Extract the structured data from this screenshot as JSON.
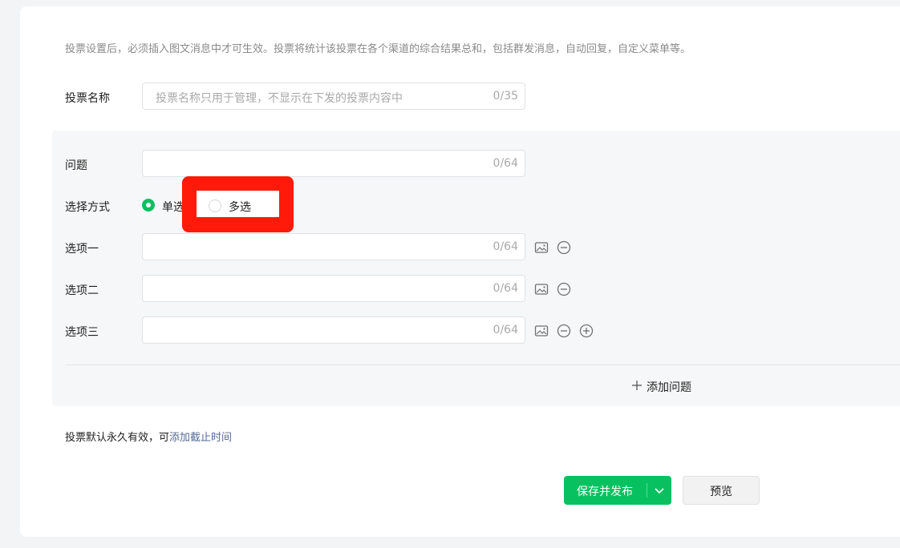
{
  "notice": "投票设置后，必须插入图文消息中才可生效。投票将统计该投票在各个渠道的综合结果总和，包括群发消息，自动回复，自定义菜单等。",
  "vote_name": {
    "label": "投票名称",
    "placeholder": "投票名称只用于管理，不显示在下发的投票内容中",
    "value": "",
    "counter": "0/35"
  },
  "question": {
    "label": "问题",
    "value": "",
    "counter": "0/64"
  },
  "selection_mode": {
    "label": "选择方式",
    "options": [
      "单选",
      "多选"
    ],
    "selected": "单选"
  },
  "options": [
    {
      "label": "选项一",
      "value": "",
      "counter": "0/64",
      "icons": [
        "image-icon",
        "minus-circle-icon"
      ]
    },
    {
      "label": "选项二",
      "value": "",
      "counter": "0/64",
      "icons": [
        "image-icon",
        "minus-circle-icon"
      ]
    },
    {
      "label": "选项三",
      "value": "",
      "counter": "0/64",
      "icons": [
        "image-icon",
        "minus-circle-icon",
        "plus-circle-icon"
      ]
    }
  ],
  "add_question": "添加问题",
  "deadline_text": "投票默认永久有效，可",
  "deadline_link": "添加截止时间",
  "buttons": {
    "save_publish": "保存并发布",
    "preview": "预览"
  },
  "colors": {
    "primary": "#07c160",
    "link": "#576b95",
    "highlight": "#ff1a0a"
  }
}
